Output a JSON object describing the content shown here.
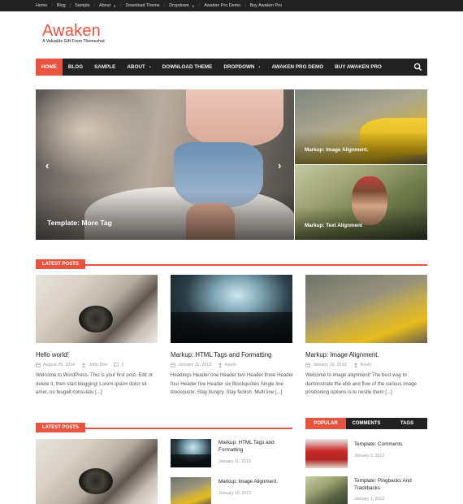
{
  "topbar": {
    "items": [
      {
        "label": "Home"
      },
      {
        "label": "Blog"
      },
      {
        "label": "Sample"
      },
      {
        "label": "About",
        "has_caret": true
      },
      {
        "label": "Download Theme"
      },
      {
        "label": "Dropdown",
        "has_caret": true
      },
      {
        "label": "Awaken Pro Demo"
      },
      {
        "label": "Buy Awaken Pro"
      }
    ]
  },
  "brand": {
    "title": "Awaken",
    "tagline": "A Valuable Gift From Themezhut"
  },
  "nav": {
    "items": [
      {
        "label": "HOME",
        "active": true
      },
      {
        "label": "BLOG"
      },
      {
        "label": "SAMPLE"
      },
      {
        "label": "ABOUT",
        "arrow": "›"
      },
      {
        "label": "DOWNLOAD THEME"
      },
      {
        "label": "DROPDOWN",
        "arrow": "›"
      },
      {
        "label": "AWAKEN PRO DEMO"
      },
      {
        "label": "BUY AWAKEN PRO"
      }
    ],
    "search_icon": "search-icon"
  },
  "slider": {
    "main_caption": "Template: More Tag",
    "prev_glyph": "‹",
    "next_glyph": "›",
    "side": [
      {
        "caption": "Markup: Image Alignment."
      },
      {
        "caption": "Markup: Text Alignment"
      }
    ]
  },
  "latest1": {
    "heading": "LATEST POSTS",
    "posts": [
      {
        "title": "Hello world!",
        "date": "August 25, 2014",
        "author": "John Doe",
        "comments": "2",
        "excerpt": "Welcome to WordPress. This is your first post. Edit or delete it, then start blogging! Lorem ipsum dolor sit amet, no feugait consulatu [...]"
      },
      {
        "title": "Markup: HTML Tags and Formatting",
        "date": "January 11, 2013",
        "author": "Kevin",
        "excerpt": "Headings Header one Header two Header three Header four Header five Header six Blockquotes Single line blockquote: Stay hungry. Stay foolish. Multi line [...]"
      },
      {
        "title": "Markup: Image Alignment.",
        "date": "January 10, 2013",
        "author": "Kevin",
        "excerpt": "Welcome to image alignment! The best way to demonstrate the ebb and flow of the various image positioning options is to nestle them [...]"
      }
    ]
  },
  "latest2": {
    "heading": "LATEST POSTS",
    "small_posts": [
      {
        "title": "Markup: HTML Tags and Formatting",
        "date": "January 11, 2013"
      },
      {
        "title": "Markup: Image Alignment.",
        "date": "January 10, 2013"
      }
    ]
  },
  "widget": {
    "tabs": [
      {
        "label": "POPULAR",
        "active": true
      },
      {
        "label": "COMMENTS"
      },
      {
        "label": "TAGS"
      }
    ],
    "items": [
      {
        "title": "Template: Comments",
        "date": "January 3, 2012"
      },
      {
        "title": "Template: Pingbacks And Trackbacks",
        "date": "January 1, 2012"
      }
    ]
  },
  "colors": {
    "accent": "#e8543f",
    "dark": "#222222"
  }
}
